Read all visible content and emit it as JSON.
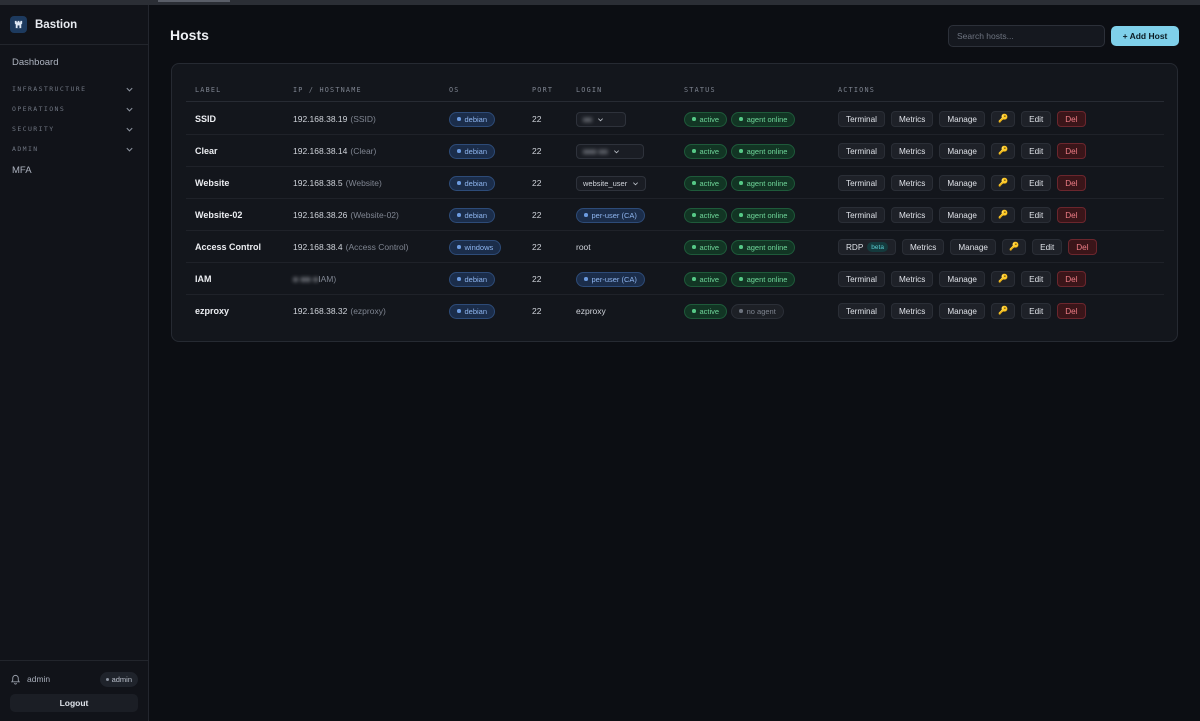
{
  "app": {
    "name": "Bastion"
  },
  "sidebar": {
    "dashboard": "Dashboard",
    "groups": [
      "INFRASTRUCTURE",
      "OPERATIONS",
      "SECURITY",
      "ADMIN"
    ],
    "mfa": "MFA",
    "user": "admin",
    "role": "admin",
    "logout": "Logout"
  },
  "header": {
    "title": "Hosts",
    "search_placeholder": "Search hosts...",
    "add_label": "+ Add Host"
  },
  "table": {
    "columns": [
      "LABEL",
      "IP / HOSTNAME",
      "OS",
      "PORT",
      "LOGIN",
      "STATUS",
      "ACTIONS"
    ],
    "rows": [
      {
        "label": "SSID",
        "ip": "192.168.38.19",
        "ip_sub": "(SSID)",
        "os": "debian",
        "port": "22",
        "login": "●●",
        "status": "active",
        "agent": "agent online"
      },
      {
        "label": "Clear",
        "ip": "192.168.38.14",
        "ip_sub": "(Clear)",
        "os": "debian",
        "port": "22",
        "login": "●●●  ●●",
        "status": "active",
        "agent": "agent online"
      },
      {
        "label": "Website",
        "ip": "192.168.38.5",
        "ip_sub": "(Website)",
        "os": "debian",
        "port": "22",
        "login": "website_user",
        "status": "active",
        "agent": "agent online"
      },
      {
        "label": "Website-02",
        "ip": "192.168.38.26",
        "ip_sub": "(Website-02)",
        "os": "debian",
        "port": "22",
        "login": "per-user (CA)",
        "status": "active",
        "agent": "agent online"
      },
      {
        "label": "Access Control",
        "ip": "192.168.38.4",
        "ip_sub": "(Access Control)",
        "os": "windows",
        "port": "22",
        "login": "root",
        "status": "active",
        "agent": "agent online"
      },
      {
        "label": "IAM",
        "ip": "●   ●●   ●",
        "ip_sub": "IAM)",
        "os": "debian",
        "port": "22",
        "login": "per-user (CA)",
        "status": "active",
        "agent": "agent online"
      },
      {
        "label": "ezproxy",
        "ip": "192.168.38.32",
        "ip_sub": "(ezproxy)",
        "os": "debian",
        "port": "22",
        "login": "ezproxy",
        "status": "active",
        "agent": "no agent"
      }
    ],
    "actions": {
      "terminal": "Terminal",
      "rdp": "RDP",
      "beta": "beta",
      "metrics": "Metrics",
      "manage": "Manage",
      "key": "🔑",
      "edit": "Edit",
      "del": "Del"
    }
  }
}
